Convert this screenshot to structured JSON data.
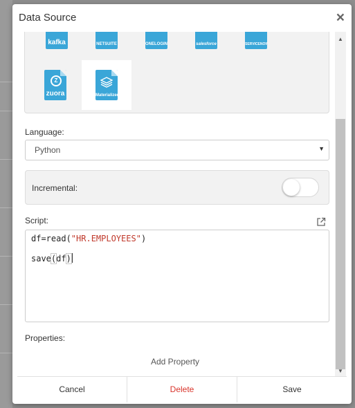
{
  "modal": {
    "title": "Data Source",
    "close_glyph": "×"
  },
  "connectors": [
    {
      "id": "kafka",
      "label": "kafka",
      "icon": "kafka-icon"
    },
    {
      "id": "netsuite",
      "label": "NETSUITE",
      "icon": "netsuite-icon"
    },
    {
      "id": "onelogin",
      "label": "ONELOGIN",
      "icon": "onelogin-icon"
    },
    {
      "id": "salesforce",
      "label": "salesforce",
      "icon": "salesforce-icon"
    },
    {
      "id": "servicenow",
      "label": "SERVICENOW",
      "icon": "servicenow-icon"
    },
    {
      "id": "zuora",
      "label": "zuora",
      "glyph": "Z",
      "icon": "zuora-icon"
    },
    {
      "id": "materialized",
      "label": "Materialized",
      "icon": "materialized-icon",
      "selected": true
    }
  ],
  "language": {
    "label": "Language:",
    "value": "Python"
  },
  "incremental": {
    "label": "Incremental:",
    "enabled": false
  },
  "script": {
    "label": "Script:",
    "lines": [
      {
        "fn": "df=read(",
        "str": "\"HR.EMPLOYEES\"",
        "close": ")"
      },
      {
        "fn": "save",
        "open": "(",
        "arg": "df",
        "close": ")"
      }
    ]
  },
  "properties": {
    "label": "Properties:",
    "add_label": "Add Property"
  },
  "footer": {
    "cancel": "Cancel",
    "delete": "Delete",
    "save": "Save"
  },
  "colors": {
    "connector": "#3aa6d8",
    "danger": "#d9342b"
  }
}
